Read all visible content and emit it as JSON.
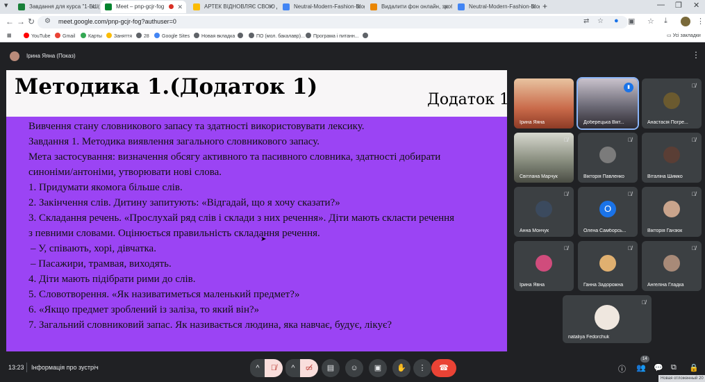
{
  "tabs": [
    {
      "title": "Завдання для курса \"1-БШ(3)...",
      "color": "#188038"
    },
    {
      "title": "Meet – pnp-gcjr-fog",
      "color": "#00832d"
    },
    {
      "title": "АРТЕК ВІДНОВЛЯЄ СВОЮ ДІЯ...",
      "color": "#fbbc04"
    },
    {
      "title": "Neutral-Modern-Fashion-Blog...",
      "color": "#4285f4"
    },
    {
      "title": "Видалити фон онлайн, зробі...",
      "color": "#ea8600"
    },
    {
      "title": "Neutral-Modern-Fashion-Blog...",
      "color": "#4285f4"
    }
  ],
  "url": "meet.google.com/pnp-gcjr-fog?authuser=0",
  "bookmarks": [
    {
      "label": "YouTube",
      "color": "#ff0000"
    },
    {
      "label": "Gmail",
      "color": "#ea4335"
    },
    {
      "label": "Карты",
      "color": "#34a853"
    },
    {
      "label": "Заняття",
      "color": "#fbbc04"
    },
    {
      "label": "28",
      "color": "#5f6368"
    },
    {
      "label": "Google Sites",
      "color": "#4285f4"
    },
    {
      "label": "Новая вкладка",
      "color": "#5f6368"
    },
    {
      "label": "",
      "color": "#5f6368"
    },
    {
      "label": "ПО (мол. бакалавр)...",
      "color": "#5f6368"
    },
    {
      "label": "Програма і питанн...",
      "color": "#5f6368"
    },
    {
      "label": "",
      "color": "#5f6368"
    }
  ],
  "bookmarks_all": "Усі закладки",
  "presenter": "Ірина Яяна (Показ)",
  "slide": {
    "title": "Методика 1.(Додаток 1)",
    "subtitle": "Додаток 1",
    "lines": [
      " Вивчення стану словникового запасу та здатності використовувати лексику.",
      "Завдання 1. Методика виявлення загального словникового запасу.",
      "Мета застосування: визначення обсягу активного та пасивного словника, здатності добирати",
      "синоніми/антоніми, утворювати нові слова.",
      "1. Придумати якомога більше слів.",
      "2. Закінчення слів. Дитину запитують: «Відгадай, що я хочу сказати?»",
      "3. Складання речень. «Прослухай ряд слів і склади з них речення». Діти мають скласти речення",
      "з певними словами. Оцінюється правильність складання речення.",
      "–     У, співають, хорі, дівчатка.",
      "–     Пасажири, трамвая, виходять.",
      "4. Діти мають підібрати рими до слів.",
      "5. Словотворення. «Як називатиметься маленький предмет?»",
      "6. «Якщо предмет зроблений із заліза, то який він?»",
      "7.  Загальний словниковий запас. Як називається людина, яка навчає, будує, лікує?"
    ]
  },
  "participants": [
    {
      "name": "Ірина Яяна",
      "muted": false,
      "color": "#c96a4a",
      "photo": true
    },
    {
      "name": "Доберецька Вікт...",
      "muted": false,
      "color": "#6d6b77",
      "photo": true,
      "speaking": true
    },
    {
      "name": "Анастасія Погре...",
      "muted": true,
      "color": "#6b5a2f"
    },
    {
      "name": "Світлана Марчук",
      "muted": true,
      "color": "#8a8f80",
      "photo": true
    },
    {
      "name": "Вікторія Павленко",
      "muted": true,
      "color": "#7b7b7b"
    },
    {
      "name": "Віталіна Шимко",
      "muted": true,
      "color": "#5a3e35"
    },
    {
      "name": "Анна Мончук",
      "muted": true,
      "color": "#3b4a5e"
    },
    {
      "name": "Олена Самборсь...",
      "muted": true,
      "color": "#1a73e8",
      "letter": "О"
    },
    {
      "name": "Вікторія Ганзюк",
      "muted": true,
      "color": "#c9a48c"
    },
    {
      "name": "Ірина Явна",
      "muted": true,
      "color": "#d04c7c"
    },
    {
      "name": "Ганна Задорожна",
      "muted": true,
      "color": "#e0b070"
    },
    {
      "name": "Ангеліна Гладка",
      "muted": true,
      "color": "#a88a78"
    },
    {
      "name": "nataliya Fedorchuk",
      "muted": true,
      "color": "#efe7df"
    }
  ],
  "bottom": {
    "time": "13:23",
    "meeting_info": "Інформація про зустріч",
    "people_count": "14"
  },
  "status": "Новая отложенный 20"
}
